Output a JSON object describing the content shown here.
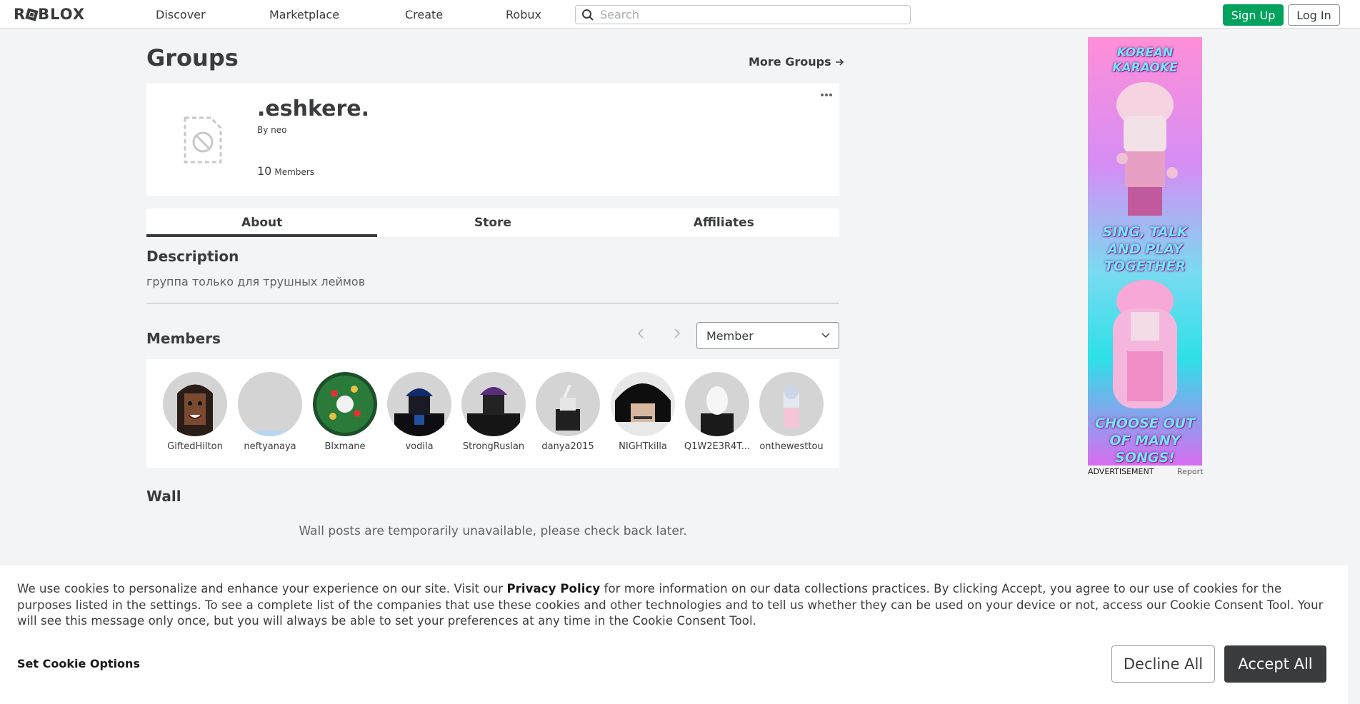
{
  "nav": {
    "logo": "ROBLOX",
    "links": [
      "Discover",
      "Marketplace",
      "Create",
      "Robux"
    ],
    "search_placeholder": "Search",
    "signup_label": "Sign Up",
    "login_label": "Log In"
  },
  "page": {
    "title": "Groups",
    "more_groups_label": "More Groups"
  },
  "group": {
    "name": ".eshkere.",
    "by_prefix": "By",
    "owner": "neo",
    "member_count": "10",
    "member_label": "Members"
  },
  "tabs": [
    "About",
    "Store",
    "Affiliates"
  ],
  "description": {
    "title": "Description",
    "text": "группа только для трушных леймов"
  },
  "members": {
    "title": "Members",
    "role_selected": "Member",
    "list": [
      {
        "name": "GiftedHilton"
      },
      {
        "name": "neftyanaya"
      },
      {
        "name": "Blxmane"
      },
      {
        "name": "vodila"
      },
      {
        "name": "StrongRuslan"
      },
      {
        "name": "danya2015"
      },
      {
        "name": "NIGHTkilla"
      },
      {
        "name": "Q1W2E3R4T..."
      },
      {
        "name": "onthewesttou"
      }
    ]
  },
  "wall": {
    "title": "Wall",
    "message": "Wall posts are temporarily unavailable, please check back later."
  },
  "ad": {
    "line1": "KOREAN KARAOKE",
    "line2": "SING, TALK AND PLAY TOGETHER",
    "line3": "CHOOSE OUT OF MANY SONGS!",
    "label": "ADVERTISEMENT",
    "report": "Report"
  },
  "cookie": {
    "text_part1": "We use cookies to personalize and enhance your experience on our site. Visit our ",
    "privacy_link": "Privacy Policy",
    "text_part2": " for more information on our data collections practices. By clicking Accept, you agree to our use of cookies for the purposes listed in the settings. To see a complete list of the companies that use these cookies and other technologies and to tell us whether they can be used on your device or not, access our Cookie Consent Tool. Your will see this message only once, but you will always be able to set your preferences at any time in the Cookie Consent Tool.",
    "options_label": "Set Cookie Options",
    "decline_label": "Decline All",
    "accept_label": "Accept All"
  }
}
